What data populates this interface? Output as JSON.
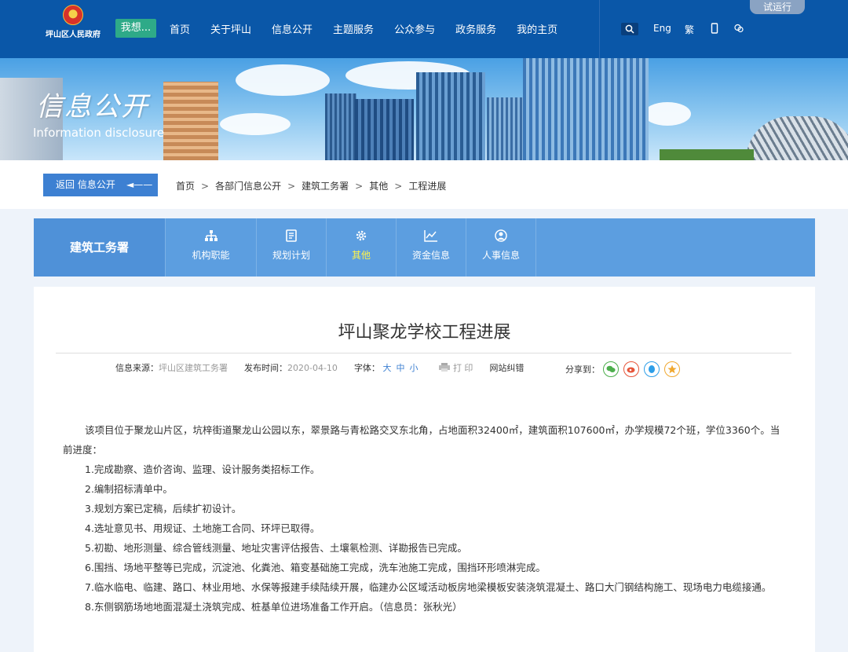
{
  "header": {
    "logo_text": "坪山区人民政府",
    "wish_label": "我想...",
    "nav": [
      "首页",
      "关于坪山",
      "信息公开",
      "主题服务",
      "公众参与",
      "政务服务",
      "我的主页"
    ],
    "tools": {
      "eng": "Eng",
      "trad": "繁"
    },
    "trial_label": "试运行"
  },
  "banner": {
    "title": "信息公开",
    "subtitle": "Information disclosure"
  },
  "breadcrumb": {
    "back_label": "返回 信息公开",
    "back_arrow": "◄——",
    "items": [
      "首页",
      "各部门信息公开",
      "建筑工务署",
      "其他",
      "工程进展"
    ],
    "separator": ">"
  },
  "dept": {
    "name": "建筑工务署",
    "items": [
      {
        "label": "机构职能",
        "icon": "org-chart-icon"
      },
      {
        "label": "规划计划",
        "icon": "document-icon"
      },
      {
        "label": "其他",
        "icon": "gear-icon",
        "active": true
      },
      {
        "label": "资金信息",
        "icon": "line-chart-icon"
      },
      {
        "label": "人事信息",
        "icon": "person-icon"
      }
    ]
  },
  "article": {
    "title": "坪山聚龙学校工程进展",
    "meta": {
      "source_label": "信息来源：",
      "source": "坪山区建筑工务署",
      "date_label": "发布时间：",
      "date": "2020-04-10",
      "font_label": "字体：",
      "sizes": [
        "大",
        "中",
        "小"
      ],
      "print_label": "打 印",
      "error_label": "网站纠错",
      "share_label": "分享到："
    },
    "paragraphs": [
      "该项目位于聚龙山片区，坑梓街道聚龙山公园以东，翠景路与青松路交叉东北角，占地面积32400㎡，建筑面积107600㎡，办学规模72个班，学位3360个。当前进度：",
      "1.完成勘察、造价咨询、监理、设计服务类招标工作。",
      "2.编制招标清单中。",
      "3.规划方案已定稿，后续扩初设计。",
      "4.选址意见书、用规证、土地施工合同、环坪已取得。",
      "5.初勘、地形测量、综合管线测量、地址灾害评估报告、土壤氡检测、详勘报告已完成。",
      "6.围挡、场地平整等已完成，沉淀池、化粪池、箱变基础施工完成，洗车池施工完成，围挡环形喷淋完成。",
      "7.临水临电、临建、路口、林业用地、水保等报建手续陆续开展，临建办公区域活动板房地梁模板安装浇筑混凝土、路口大门钢结构施工、现场电力电缆接通。",
      "8.东侧钢筋场地地面混凝土浇筑完成、桩基单位进场准备工作开启。（信息员：张秋光）"
    ]
  },
  "colors": {
    "header_bg": "#0a57a8",
    "nav_bg": "#5c9ee0",
    "active": "#fff34a",
    "accent": "#3d80d2",
    "wish_btn": "#2eaa88"
  }
}
